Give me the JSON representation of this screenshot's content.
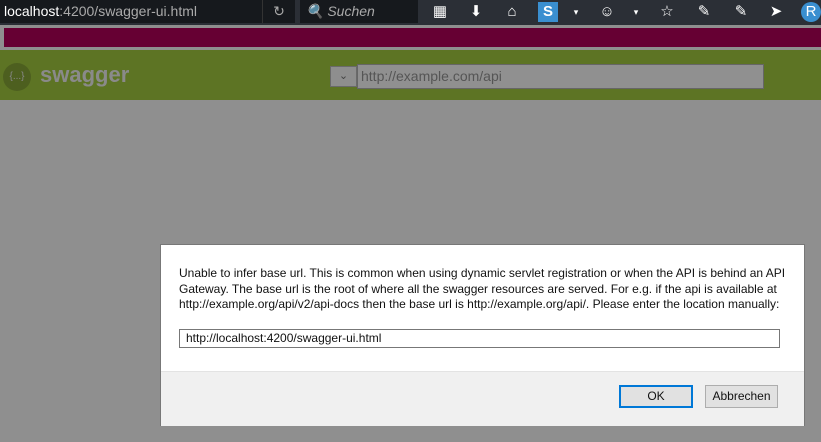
{
  "browser": {
    "url_host": "localhost",
    "url_rest": ":4200/swagger-ui.html",
    "search_placeholder": "Suchen"
  },
  "header": {
    "brand": "swagger",
    "logo": "{...}",
    "api_url": "http://example.com/api"
  },
  "dialog": {
    "message": "Unable to infer base url. This is common when using dynamic servlet registration or when the API is behind an API Gateway. The base url is the root of where all the swagger resources are served. For e.g. if the api is available at http://example.org/api/v2/api-docs then the base url is http://example.org/api/. Please enter the location manually:",
    "base_url": "http://localhost:4200/swagger-ui.html",
    "ok_label": "OK",
    "cancel_label": "Abbrechen"
  },
  "colors": {
    "header": "#5d7424",
    "accent": "#0078d7",
    "magenta": "#660033"
  }
}
